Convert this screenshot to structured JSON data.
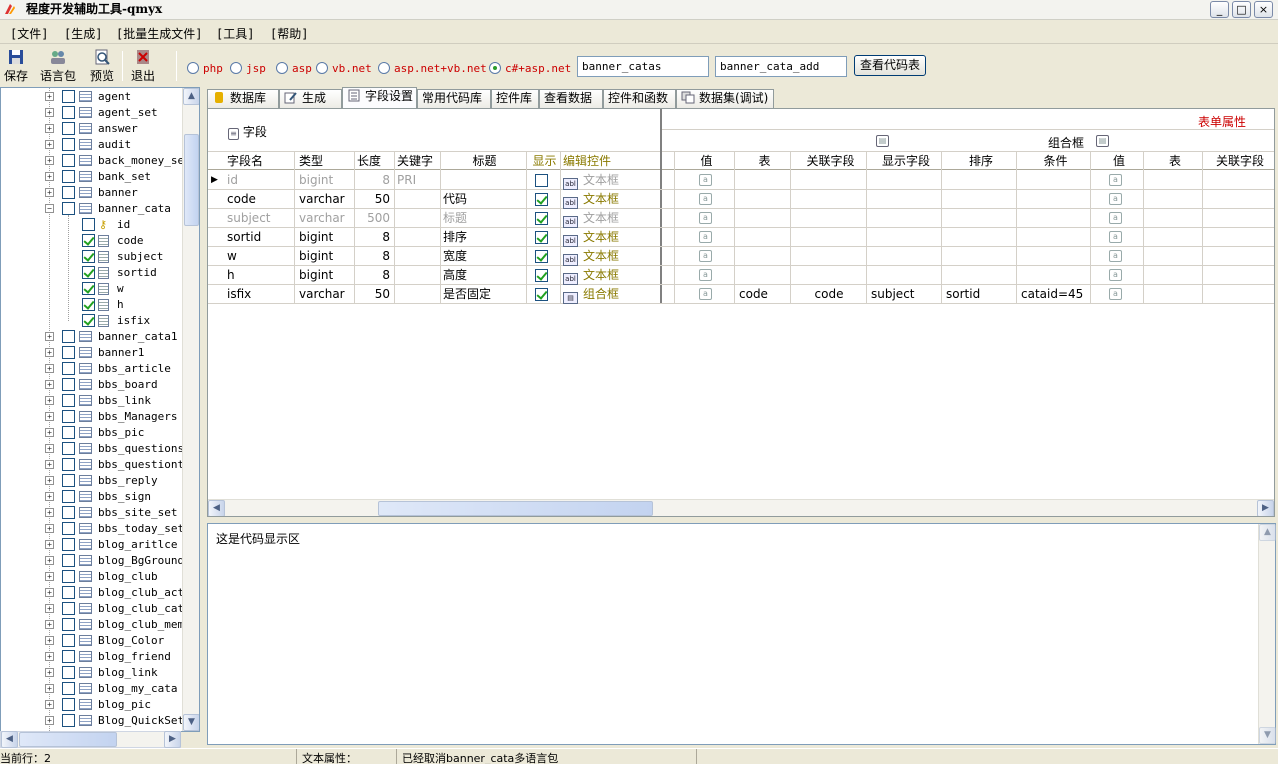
{
  "window": {
    "title": "程度开发辅助工具-qmyx",
    "minimize": "_",
    "maximize": "□",
    "close": "×"
  },
  "menu": [
    "[文件]",
    "[生成]",
    "[批量生成文件]",
    "[工具]",
    "[帮助]"
  ],
  "toolbar": {
    "save": "保存",
    "lang": "语言包",
    "preview": "预览",
    "exit": "退出",
    "radios": [
      {
        "label": "php",
        "selected": false
      },
      {
        "label": "jsp",
        "selected": false
      },
      {
        "label": "asp",
        "selected": false
      },
      {
        "label": "vb.net",
        "selected": false
      },
      {
        "label": "asp.net+vb.net",
        "selected": false
      },
      {
        "label": "c#+asp.net",
        "selected": true
      }
    ],
    "table_name": "banner_catas",
    "add_name": "banner_cata_add",
    "view_code_button": "查看代码表"
  },
  "tree": {
    "items_before": [
      "agent",
      "agent_set",
      "answer",
      "audit",
      "back_money_set",
      "bank_set",
      "banner"
    ],
    "expanded": {
      "name": "banner_cata",
      "fields": [
        {
          "name": "id",
          "checked": false,
          "key": true
        },
        {
          "name": "code",
          "checked": true,
          "key": false
        },
        {
          "name": "subject",
          "checked": true,
          "key": false
        },
        {
          "name": "sortid",
          "checked": true,
          "key": false
        },
        {
          "name": "w",
          "checked": true,
          "key": false
        },
        {
          "name": "h",
          "checked": true,
          "key": false
        },
        {
          "name": "isfix",
          "checked": true,
          "key": false
        }
      ]
    },
    "items_after": [
      "banner_cata1",
      "banner1",
      "bbs_article",
      "bbs_board",
      "bbs_link",
      "bbs_Managers",
      "bbs_pic",
      "bbs_questions",
      "bbs_questionti",
      "bbs_reply",
      "bbs_sign",
      "bbs_site_set",
      "bbs_today_set",
      "blog_aritlce",
      "blog_BgGround",
      "blog_club",
      "blog_club_acti",
      "blog_club_cata",
      "blog_club_memb",
      "Blog_Color",
      "blog_friend",
      "blog_link",
      "blog_my_cata",
      "blog_pic",
      "Blog_QuickSet"
    ]
  },
  "tabs": [
    "数据库",
    "生成",
    "字段设置",
    "常用代码库",
    "控件库",
    "查看数据",
    "控件和函数",
    "数据集(调试)"
  ],
  "active_tab": 2,
  "grid": {
    "field_group": "字段",
    "form_props": "表单属性",
    "combo_group": "组合框",
    "left_columns": [
      "字段名",
      "类型",
      "长度",
      "关键字",
      "标题",
      "显示",
      "编辑控件"
    ],
    "right_columns": [
      "值",
      "表",
      "关联字段",
      "显示字段",
      "排序",
      "条件",
      "值",
      "表",
      "关联字段"
    ],
    "rows": [
      {
        "name": "id",
        "type": "bigint",
        "len": "8",
        "key": "PRI",
        "title": "",
        "show": false,
        "control": "文本框",
        "combo": false,
        "disabled": true,
        "current": true,
        "r": [
          "",
          "",
          "",
          "",
          "",
          ""
        ]
      },
      {
        "name": "code",
        "type": "varchar",
        "len": "50",
        "key": "",
        "title": "代码",
        "show": true,
        "control": "文本框",
        "combo": false,
        "disabled": false,
        "current": false,
        "r": [
          "",
          "",
          "",
          "",
          "",
          ""
        ]
      },
      {
        "name": "subject",
        "type": "varchar",
        "len": "500",
        "key": "",
        "title": "标题",
        "show": true,
        "control": "文本框",
        "combo": false,
        "disabled": true,
        "current": false,
        "r": [
          "",
          "",
          "",
          "",
          "",
          ""
        ]
      },
      {
        "name": "sortid",
        "type": "bigint",
        "len": "8",
        "key": "",
        "title": "排序",
        "show": true,
        "control": "文本框",
        "combo": false,
        "disabled": false,
        "current": false,
        "r": [
          "",
          "",
          "",
          "",
          "",
          ""
        ]
      },
      {
        "name": "w",
        "type": "bigint",
        "len": "8",
        "key": "",
        "title": "宽度",
        "show": true,
        "control": "文本框",
        "combo": false,
        "disabled": false,
        "current": false,
        "r": [
          "",
          "",
          "",
          "",
          "",
          ""
        ]
      },
      {
        "name": "h",
        "type": "bigint",
        "len": "8",
        "key": "",
        "title": "高度",
        "show": true,
        "control": "文本框",
        "combo": false,
        "disabled": false,
        "current": false,
        "r": [
          "",
          "",
          "",
          "",
          "",
          ""
        ]
      },
      {
        "name": "isfix",
        "type": "varchar",
        "len": "50",
        "key": "",
        "title": "是否固定",
        "show": true,
        "control": "组合框",
        "combo": true,
        "disabled": false,
        "current": false,
        "r": [
          "code",
          "code",
          "subject",
          "sortid",
          "cataid=45",
          ""
        ]
      }
    ]
  },
  "code_area_text": "这是代码显示区",
  "status": {
    "current_row": "当前行：2",
    "text_attr": "文本属性：",
    "message": "已经取消banner_cata多语言包"
  },
  "colors": {
    "accent_red": "#cc0000",
    "control_olive": "#8a7a00",
    "check_green": "#21a121"
  }
}
